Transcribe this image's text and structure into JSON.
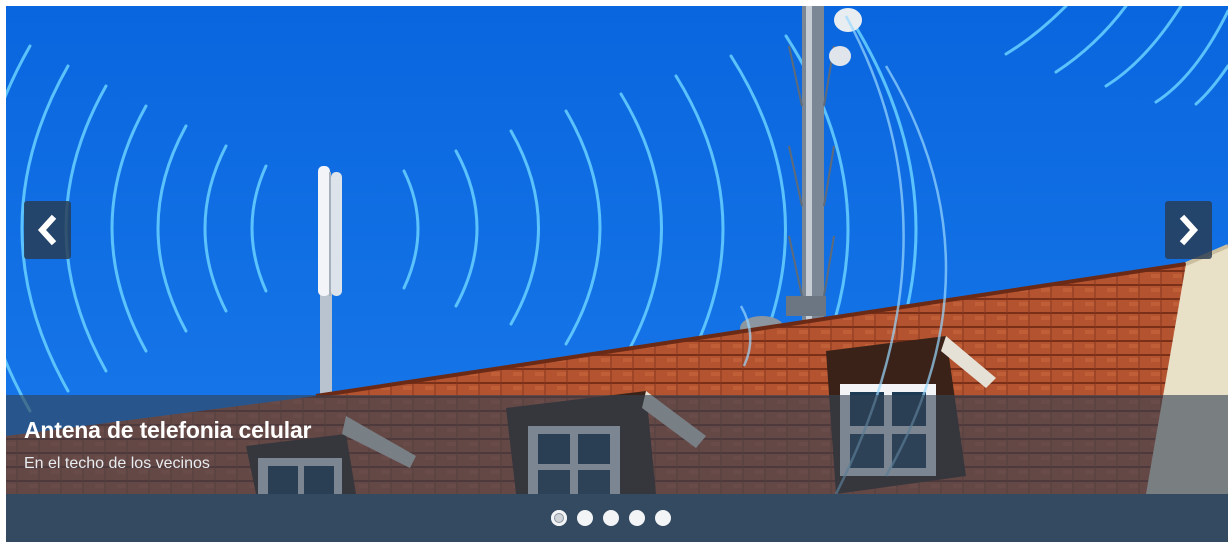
{
  "slider": {
    "caption": {
      "title": "Antena de telefonia celular",
      "subtitle": "En el techo de los vecinos"
    },
    "prev_icon": "chevron-left-icon",
    "next_icon": "chevron-right-icon",
    "dots": [
      {
        "active": true
      },
      {
        "active": false
      },
      {
        "active": false
      },
      {
        "active": false
      },
      {
        "active": false
      }
    ],
    "active_slide_index": 1,
    "slide_count": 5,
    "colors": {
      "sky": "#0a6ae0",
      "wave": "#5cc8ff",
      "roof": "#b0502c",
      "bar": "#344a61"
    }
  }
}
